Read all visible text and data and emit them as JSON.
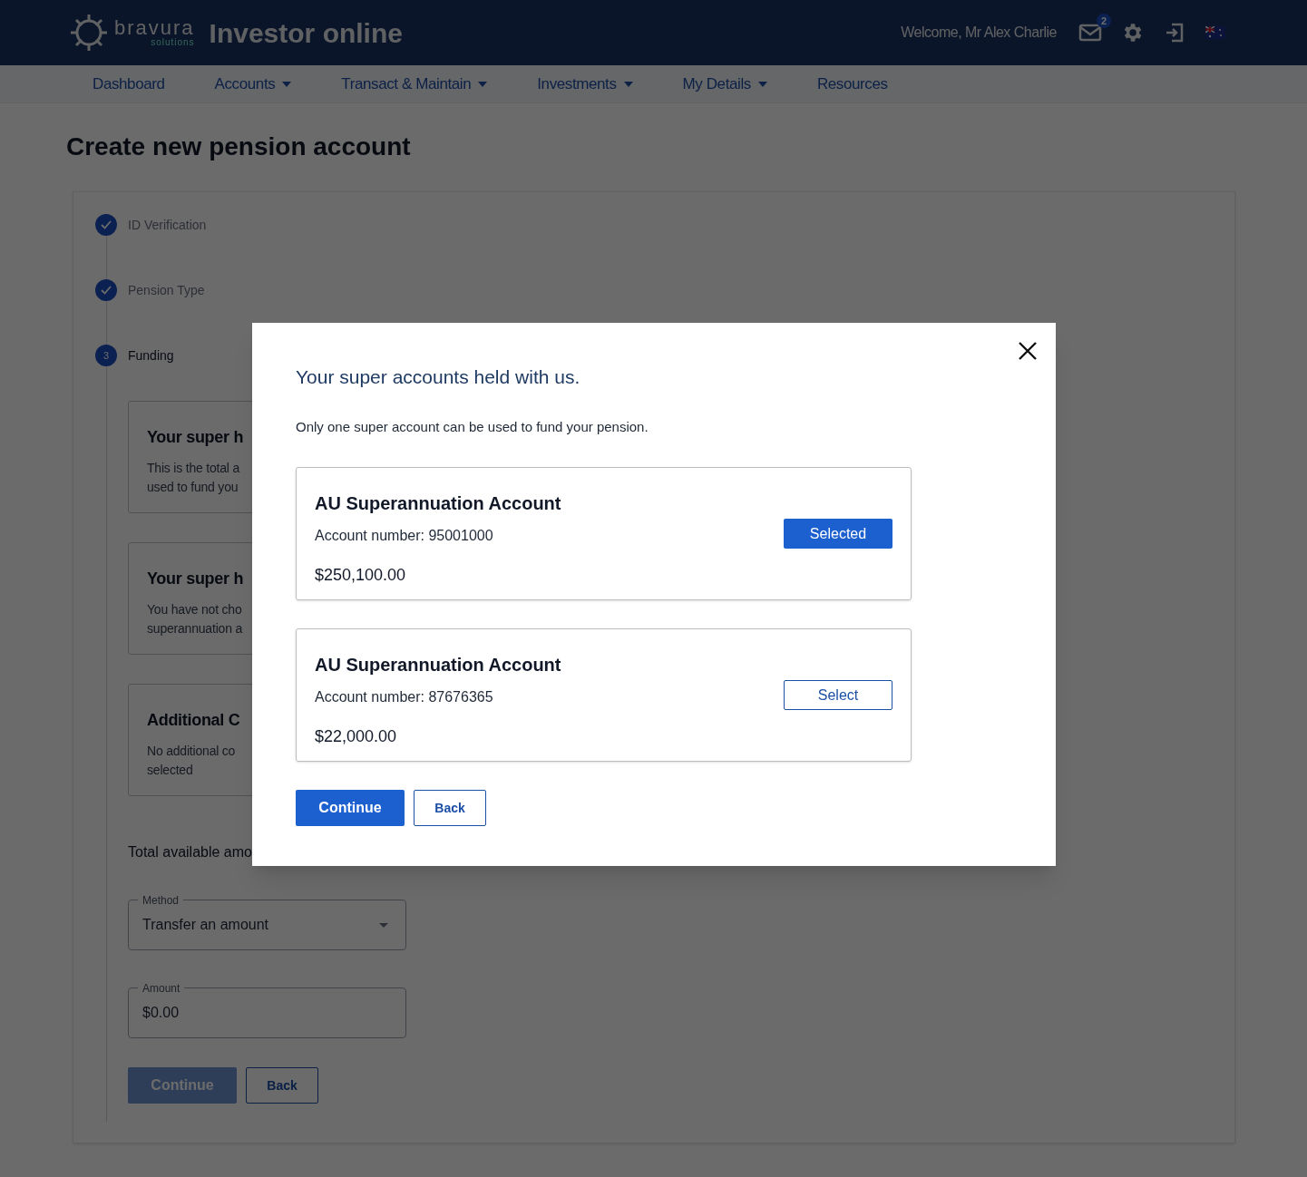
{
  "header": {
    "logo_word": "bravura",
    "logo_sub": "solutions",
    "app_title": "Investor online",
    "welcome": "Welcome, Mr Alex Charlie",
    "mail_badge": "2"
  },
  "nav": [
    {
      "label": "Dashboard",
      "has_menu": false
    },
    {
      "label": "Accounts",
      "has_menu": true
    },
    {
      "label": "Transact & Maintain",
      "has_menu": true
    },
    {
      "label": "Investments",
      "has_menu": true
    },
    {
      "label": "My Details",
      "has_menu": true
    },
    {
      "label": "Resources",
      "has_menu": false
    }
  ],
  "page_title": "Create new pension account",
  "steps": [
    {
      "label": "ID Verification",
      "completed": true
    },
    {
      "label": "Pension Type",
      "completed": true
    },
    {
      "label": "Funding",
      "completed": false,
      "number": "3"
    }
  ],
  "summary_cards": [
    {
      "title": "Your super h",
      "lines": [
        "This is the total a",
        "used to fund you"
      ]
    },
    {
      "title": "Your super h",
      "lines": [
        "You have not cho",
        "superannuation a"
      ]
    },
    {
      "title": "Additional C",
      "lines": [
        "No additional co",
        "selected"
      ]
    }
  ],
  "total_label": "Total available amo",
  "method_field": {
    "label": "Method",
    "value": "Transfer an amount"
  },
  "amount_field": {
    "label": "Amount",
    "value": "$0.00"
  },
  "form_buttons": [
    {
      "label": "Continue",
      "kind": "primary",
      "disabled": true
    },
    {
      "label": "Back",
      "kind": "outline",
      "disabled": false
    }
  ],
  "modal": {
    "title": "Your super accounts held with us.",
    "subtitle": "Only one super account can be used to fund your pension.",
    "accounts": [
      {
        "name": "AU Superannuation Account",
        "number": "Account number: 95001000",
        "balance": "$250,100.00",
        "button": "Selected",
        "selected": true
      },
      {
        "name": "AU Superannuation Account",
        "number": "Account number: 87676365",
        "balance": "$22,000.00",
        "button": "Select",
        "selected": false
      }
    ],
    "buttons": [
      {
        "label": "Continue",
        "kind": "primary",
        "disabled": false
      },
      {
        "label": "Back",
        "kind": "outline",
        "disabled": false
      }
    ]
  }
}
